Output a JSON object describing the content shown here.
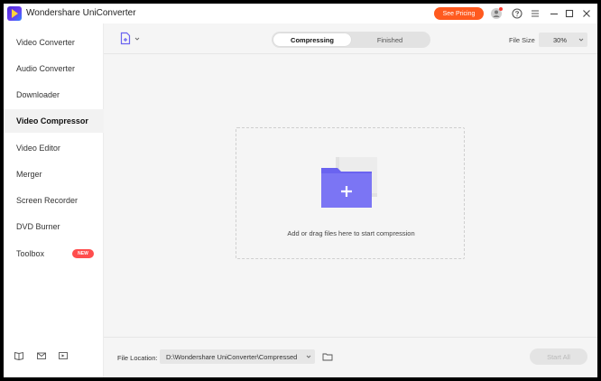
{
  "app": {
    "title": "Wondershare UniConverter",
    "pricing_label": "See Pricing",
    "icons": [
      "app-logo-icon",
      "account-icon",
      "help-icon",
      "menu-icon",
      "minimize-icon",
      "maximize-icon",
      "close-icon"
    ]
  },
  "sidebar": {
    "items": [
      {
        "label": "Video Converter",
        "active": false
      },
      {
        "label": "Audio Converter",
        "active": false
      },
      {
        "label": "Downloader",
        "active": false
      },
      {
        "label": "Video Compressor",
        "active": true
      },
      {
        "label": "Video Editor",
        "active": false
      },
      {
        "label": "Merger",
        "active": false
      },
      {
        "label": "Screen Recorder",
        "active": false
      },
      {
        "label": "DVD Burner",
        "active": false
      },
      {
        "label": "Toolbox",
        "active": false,
        "badge": "NEW"
      }
    ],
    "bottom_icons": [
      "guide-book-icon",
      "feedback-mail-icon",
      "media-library-icon"
    ]
  },
  "toolbar": {
    "tabs": [
      {
        "label": "Compressing",
        "active": true
      },
      {
        "label": "Finished",
        "active": false
      }
    ],
    "file_size_label": "File Size",
    "file_size_value": "30%"
  },
  "dropzone": {
    "text": "Add or drag files here to start compression",
    "icon": "add-folder-icon"
  },
  "bottom": {
    "file_location_label": "File Location:",
    "file_location_value": "D:\\Wondershare UniConverter\\Compressed",
    "start_all_label": "Start All"
  },
  "colors": {
    "accent": "#ff5a1f",
    "folder_purple": "#6a63f0",
    "new_badge": "#ff4d4d",
    "main_bg": "#f5f5f5"
  }
}
